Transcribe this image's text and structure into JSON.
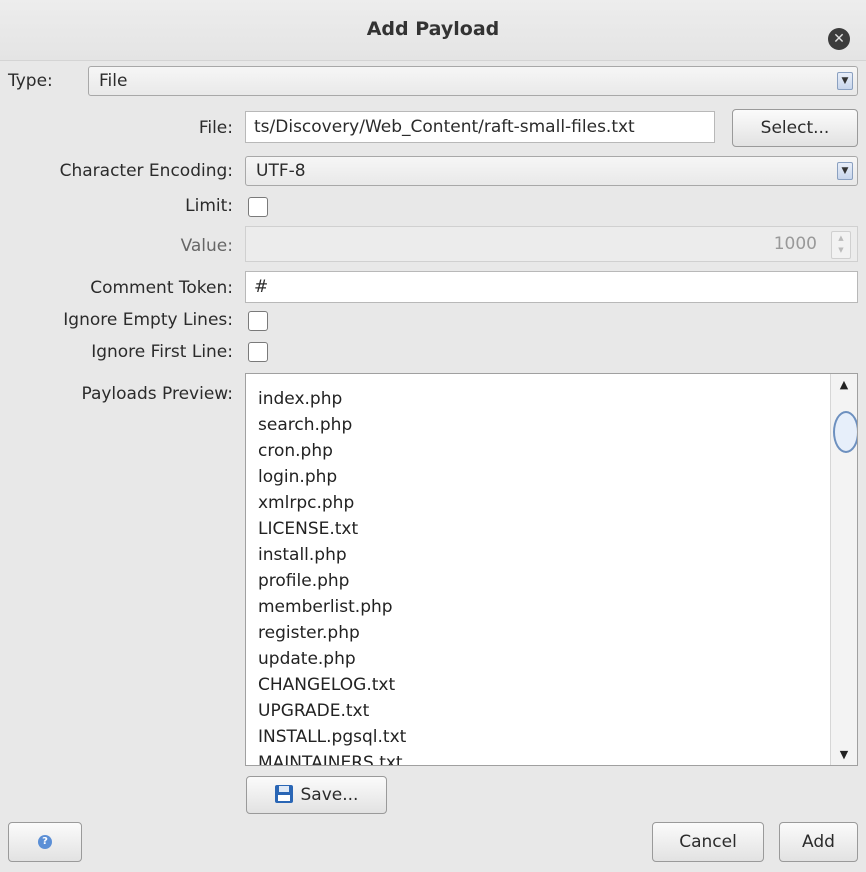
{
  "dialog": {
    "title": "Add Payload",
    "close_icon": "close-icon"
  },
  "type": {
    "label": "Type:",
    "value": "File"
  },
  "file": {
    "label": "File:",
    "value": "ts/Discovery/Web_Content/raft-small-files.txt",
    "select_label": "Select..."
  },
  "encoding": {
    "label": "Character Encoding:",
    "value": "UTF-8"
  },
  "limit": {
    "label": "Limit:",
    "checked": false
  },
  "value": {
    "label": "Value:",
    "value": "1000"
  },
  "comment_token": {
    "label": "Comment Token:",
    "value": "#"
  },
  "ignore_empty": {
    "label": "Ignore Empty Lines:",
    "checked": false
  },
  "ignore_first": {
    "label": "Ignore First Line:",
    "checked": false
  },
  "preview": {
    "label": "Payloads Preview:",
    "items": [
      "index.php",
      "search.php",
      "cron.php",
      "login.php",
      "xmlrpc.php",
      "LICENSE.txt",
      "install.php",
      "profile.php",
      "memberlist.php",
      "register.php",
      "update.php",
      "CHANGELOG.txt",
      "UPGRADE.txt",
      "INSTALL.pgsql.txt",
      "MAINTAINERS.txt"
    ]
  },
  "footer": {
    "save_label": "Save...",
    "cancel_label": "Cancel",
    "add_label": "Add",
    "help_icon": "help-icon"
  },
  "colors": {
    "accent": "#2a66b5",
    "scroll_thumb": "#6d90bf"
  }
}
